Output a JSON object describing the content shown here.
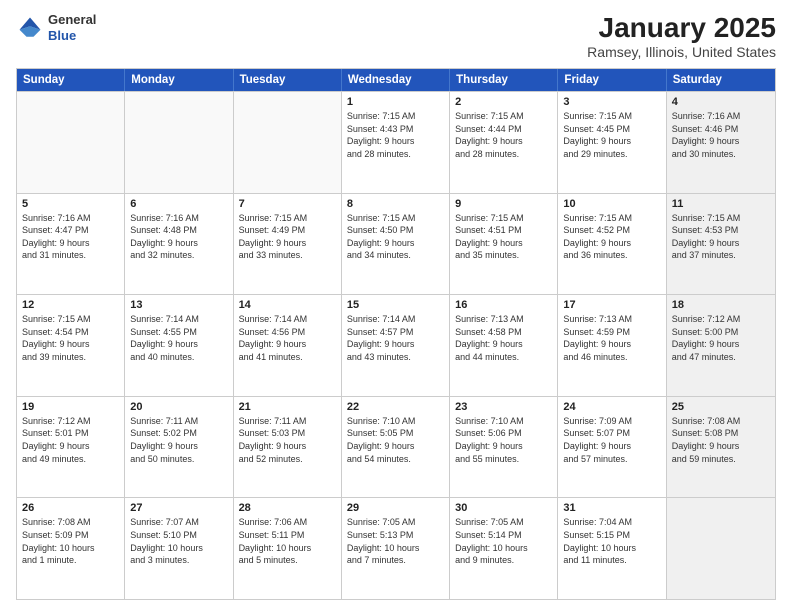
{
  "header": {
    "logo_general": "General",
    "logo_blue": "Blue",
    "title": "January 2025",
    "subtitle": "Ramsey, Illinois, United States"
  },
  "calendar": {
    "days_of_week": [
      "Sunday",
      "Monday",
      "Tuesday",
      "Wednesday",
      "Thursday",
      "Friday",
      "Saturday"
    ],
    "rows": [
      [
        {
          "day": "",
          "info": "",
          "shaded": false
        },
        {
          "day": "",
          "info": "",
          "shaded": false
        },
        {
          "day": "",
          "info": "",
          "shaded": false
        },
        {
          "day": "1",
          "info": "Sunrise: 7:15 AM\nSunset: 4:43 PM\nDaylight: 9 hours\nand 28 minutes.",
          "shaded": false
        },
        {
          "day": "2",
          "info": "Sunrise: 7:15 AM\nSunset: 4:44 PM\nDaylight: 9 hours\nand 28 minutes.",
          "shaded": false
        },
        {
          "day": "3",
          "info": "Sunrise: 7:15 AM\nSunset: 4:45 PM\nDaylight: 9 hours\nand 29 minutes.",
          "shaded": false
        },
        {
          "day": "4",
          "info": "Sunrise: 7:16 AM\nSunset: 4:46 PM\nDaylight: 9 hours\nand 30 minutes.",
          "shaded": true
        }
      ],
      [
        {
          "day": "5",
          "info": "Sunrise: 7:16 AM\nSunset: 4:47 PM\nDaylight: 9 hours\nand 31 minutes.",
          "shaded": false
        },
        {
          "day": "6",
          "info": "Sunrise: 7:16 AM\nSunset: 4:48 PM\nDaylight: 9 hours\nand 32 minutes.",
          "shaded": false
        },
        {
          "day": "7",
          "info": "Sunrise: 7:15 AM\nSunset: 4:49 PM\nDaylight: 9 hours\nand 33 minutes.",
          "shaded": false
        },
        {
          "day": "8",
          "info": "Sunrise: 7:15 AM\nSunset: 4:50 PM\nDaylight: 9 hours\nand 34 minutes.",
          "shaded": false
        },
        {
          "day": "9",
          "info": "Sunrise: 7:15 AM\nSunset: 4:51 PM\nDaylight: 9 hours\nand 35 minutes.",
          "shaded": false
        },
        {
          "day": "10",
          "info": "Sunrise: 7:15 AM\nSunset: 4:52 PM\nDaylight: 9 hours\nand 36 minutes.",
          "shaded": false
        },
        {
          "day": "11",
          "info": "Sunrise: 7:15 AM\nSunset: 4:53 PM\nDaylight: 9 hours\nand 37 minutes.",
          "shaded": true
        }
      ],
      [
        {
          "day": "12",
          "info": "Sunrise: 7:15 AM\nSunset: 4:54 PM\nDaylight: 9 hours\nand 39 minutes.",
          "shaded": false
        },
        {
          "day": "13",
          "info": "Sunrise: 7:14 AM\nSunset: 4:55 PM\nDaylight: 9 hours\nand 40 minutes.",
          "shaded": false
        },
        {
          "day": "14",
          "info": "Sunrise: 7:14 AM\nSunset: 4:56 PM\nDaylight: 9 hours\nand 41 minutes.",
          "shaded": false
        },
        {
          "day": "15",
          "info": "Sunrise: 7:14 AM\nSunset: 4:57 PM\nDaylight: 9 hours\nand 43 minutes.",
          "shaded": false
        },
        {
          "day": "16",
          "info": "Sunrise: 7:13 AM\nSunset: 4:58 PM\nDaylight: 9 hours\nand 44 minutes.",
          "shaded": false
        },
        {
          "day": "17",
          "info": "Sunrise: 7:13 AM\nSunset: 4:59 PM\nDaylight: 9 hours\nand 46 minutes.",
          "shaded": false
        },
        {
          "day": "18",
          "info": "Sunrise: 7:12 AM\nSunset: 5:00 PM\nDaylight: 9 hours\nand 47 minutes.",
          "shaded": true
        }
      ],
      [
        {
          "day": "19",
          "info": "Sunrise: 7:12 AM\nSunset: 5:01 PM\nDaylight: 9 hours\nand 49 minutes.",
          "shaded": false
        },
        {
          "day": "20",
          "info": "Sunrise: 7:11 AM\nSunset: 5:02 PM\nDaylight: 9 hours\nand 50 minutes.",
          "shaded": false
        },
        {
          "day": "21",
          "info": "Sunrise: 7:11 AM\nSunset: 5:03 PM\nDaylight: 9 hours\nand 52 minutes.",
          "shaded": false
        },
        {
          "day": "22",
          "info": "Sunrise: 7:10 AM\nSunset: 5:05 PM\nDaylight: 9 hours\nand 54 minutes.",
          "shaded": false
        },
        {
          "day": "23",
          "info": "Sunrise: 7:10 AM\nSunset: 5:06 PM\nDaylight: 9 hours\nand 55 minutes.",
          "shaded": false
        },
        {
          "day": "24",
          "info": "Sunrise: 7:09 AM\nSunset: 5:07 PM\nDaylight: 9 hours\nand 57 minutes.",
          "shaded": false
        },
        {
          "day": "25",
          "info": "Sunrise: 7:08 AM\nSunset: 5:08 PM\nDaylight: 9 hours\nand 59 minutes.",
          "shaded": true
        }
      ],
      [
        {
          "day": "26",
          "info": "Sunrise: 7:08 AM\nSunset: 5:09 PM\nDaylight: 10 hours\nand 1 minute.",
          "shaded": false
        },
        {
          "day": "27",
          "info": "Sunrise: 7:07 AM\nSunset: 5:10 PM\nDaylight: 10 hours\nand 3 minutes.",
          "shaded": false
        },
        {
          "day": "28",
          "info": "Sunrise: 7:06 AM\nSunset: 5:11 PM\nDaylight: 10 hours\nand 5 minutes.",
          "shaded": false
        },
        {
          "day": "29",
          "info": "Sunrise: 7:05 AM\nSunset: 5:13 PM\nDaylight: 10 hours\nand 7 minutes.",
          "shaded": false
        },
        {
          "day": "30",
          "info": "Sunrise: 7:05 AM\nSunset: 5:14 PM\nDaylight: 10 hours\nand 9 minutes.",
          "shaded": false
        },
        {
          "day": "31",
          "info": "Sunrise: 7:04 AM\nSunset: 5:15 PM\nDaylight: 10 hours\nand 11 minutes.",
          "shaded": false
        },
        {
          "day": "",
          "info": "",
          "shaded": true
        }
      ]
    ]
  }
}
